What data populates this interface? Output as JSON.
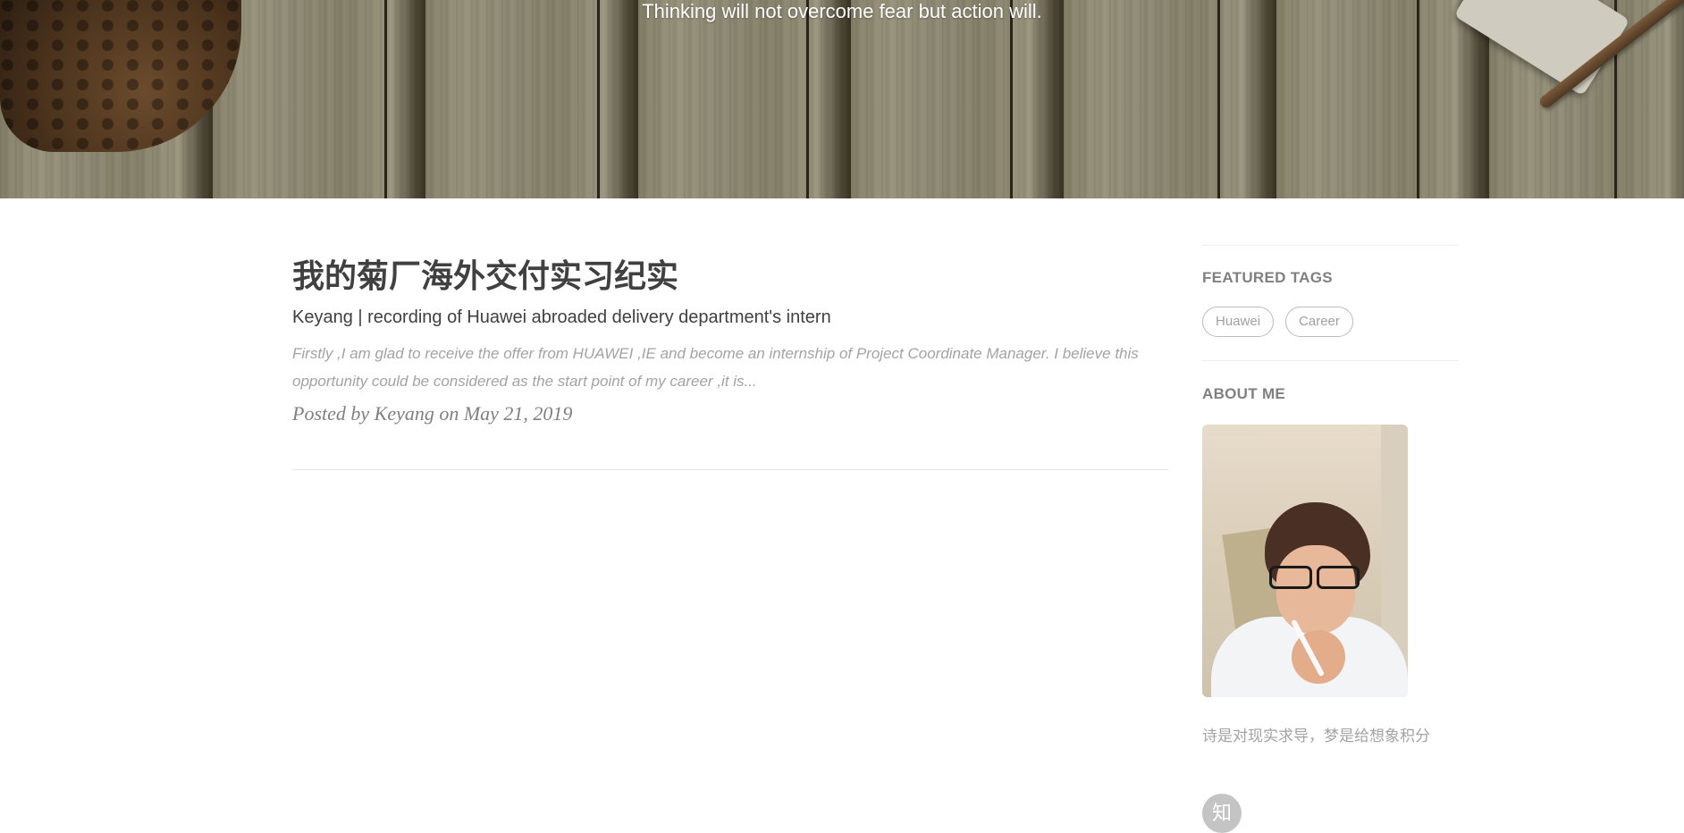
{
  "header": {
    "subheading": "Thinking will not overcome fear but action will."
  },
  "posts": [
    {
      "title": "我的菊厂海外交付实习纪实",
      "subtitle": "Keyang | recording of Huawei abroaded delivery department's intern",
      "excerpt": "Firstly ,I am glad to receive the offer from HUAWEI ,IE and become an internship of Project Coordinate Manager. I believe this opportunity could be considered as the start point of my career ,it is...",
      "meta": "Posted by Keyang on May 21, 2019"
    }
  ],
  "sidebar": {
    "featured_tags_title": "FEATURED TAGS",
    "tags": [
      "Huawei",
      "Career"
    ],
    "about_me_title": "ABOUT ME",
    "motto": "诗是对现实求导，梦是给想象积分",
    "social_icon_glyph": "知"
  },
  "icons": {
    "social": "zhihu-icon"
  }
}
